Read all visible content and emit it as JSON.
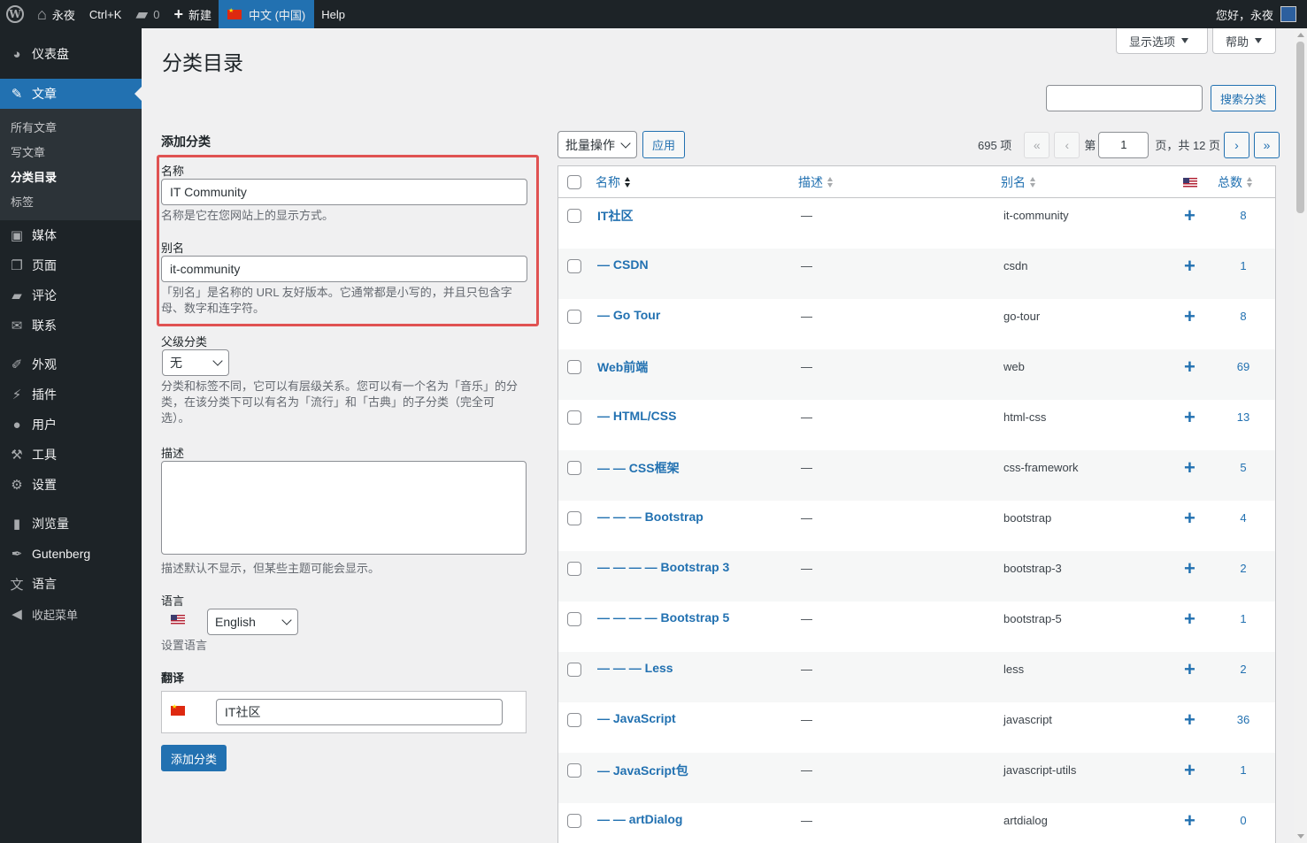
{
  "adminbar": {
    "site_name": "永夜",
    "shortcut": "Ctrl+K",
    "comments_count": "0",
    "new_label": "新建",
    "language": "中文 (中国)",
    "help": "Help",
    "greeting": "您好，永夜"
  },
  "sidebar": {
    "dashboard": "仪表盘",
    "posts": "文章",
    "sub_all_posts": "所有文章",
    "sub_write": "写文章",
    "sub_categories": "分类目录",
    "sub_tags": "标签",
    "media": "媒体",
    "pages": "页面",
    "comments": "评论",
    "contact": "联系",
    "appearance": "外观",
    "plugins": "插件",
    "users": "用户",
    "tools": "工具",
    "settings": "设置",
    "views": "浏览量",
    "gutenberg": "Gutenberg",
    "languages": "语言",
    "collapse": "收起菜单"
  },
  "header": {
    "title": "分类目录",
    "screen_options": "显示选项",
    "help": "帮助",
    "search_button": "搜索分类"
  },
  "form": {
    "heading": "添加分类",
    "name_label": "名称",
    "name_value": "IT Community",
    "name_help": "名称是它在您网站上的显示方式。",
    "slug_label": "别名",
    "slug_value": "it-community",
    "slug_help_1": "「别名」是名称的 URL 友好版本。它通常都是小写的，并且只包含字",
    "slug_help_2": "母、数字和连字符。",
    "parent_label": "父级分类",
    "parent_value": "无",
    "parent_help_1": "分类和标签不同，它可以有层级关系。您可以有一个名为「音乐」的分",
    "parent_help_2": "类，在该分类下可以有名为「流行」和「古典」的子分类（完全可",
    "parent_help_3": "选）。",
    "desc_label": "描述",
    "desc_help": "描述默认不显示，但某些主题可能会显示。",
    "lang_label": "语言",
    "lang_value": "English",
    "lang_help": "设置语言",
    "translation_label": "翻译",
    "translation_value": "IT社区",
    "submit": "添加分类"
  },
  "toolbar": {
    "bulk_actions": "批量操作",
    "apply": "应用",
    "items_count": "695 项",
    "first": "«",
    "prev": "‹",
    "page_prefix": "第",
    "current_page": "1",
    "page_suffix": "页，共 12 页",
    "next": "›",
    "last": "»"
  },
  "table": {
    "columns": {
      "name": "名称",
      "description": "描述",
      "slug": "别名",
      "count": "总数"
    },
    "rows": [
      {
        "name": "IT社区",
        "desc": "—",
        "slug": "it-community",
        "count": "8"
      },
      {
        "name": "— CSDN",
        "desc": "—",
        "slug": "csdn",
        "count": "1"
      },
      {
        "name": "— Go Tour",
        "desc": "—",
        "slug": "go-tour",
        "count": "8"
      },
      {
        "name": "Web前端",
        "desc": "—",
        "slug": "web",
        "count": "69"
      },
      {
        "name": "— HTML/CSS",
        "desc": "—",
        "slug": "html-css",
        "count": "13"
      },
      {
        "name": "— — CSS框架",
        "desc": "—",
        "slug": "css-framework",
        "count": "5"
      },
      {
        "name": "— — — Bootstrap",
        "desc": "—",
        "slug": "bootstrap",
        "count": "4"
      },
      {
        "name": "— — — — Bootstrap 3",
        "desc": "—",
        "slug": "bootstrap-3",
        "count": "2"
      },
      {
        "name": "— — — — Bootstrap 5",
        "desc": "—",
        "slug": "bootstrap-5",
        "count": "1"
      },
      {
        "name": "— — — Less",
        "desc": "—",
        "slug": "less",
        "count": "2"
      },
      {
        "name": "— JavaScript",
        "desc": "—",
        "slug": "javascript",
        "count": "36"
      },
      {
        "name": "— JavaScript包",
        "desc": "—",
        "slug": "javascript-utils",
        "count": "1"
      },
      {
        "name": "— — artDialog",
        "desc": "—",
        "slug": "artdialog",
        "count": "0"
      }
    ],
    "add_translation_icon": "plus-icon"
  },
  "colors": {
    "accent": "#2271b1",
    "sidebar_bg": "#1d2327",
    "highlight": "#e05252"
  }
}
